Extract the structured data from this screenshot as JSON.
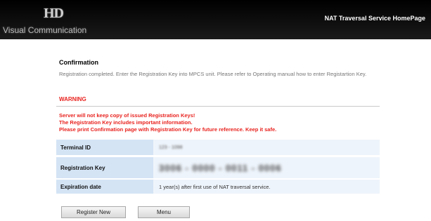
{
  "header": {
    "logo_mark": "HD",
    "logo_sub": "Visual Communication",
    "homepage_link": "NAT Traversal Service HomePage"
  },
  "confirmation": {
    "title": "Confirmation",
    "intro": "Registration completed. Enter the Registration Key into MPCS unit. Please refer to Operating manual how to enter Registartion Key."
  },
  "warning": {
    "title": "WARNING",
    "lines": [
      "Server will not keep copy of issued Registration Keys!",
      "The Registration Key includes important information.",
      "Please print Confirmation page with Registration Key for future reference. Keep it safe."
    ]
  },
  "details": [
    {
      "label": "Terminal ID",
      "value": "123 - 1098"
    },
    {
      "label": "Registration Key",
      "value": "3006 - 0000 - 0011 - 0006"
    },
    {
      "label": "Expiration date",
      "value": "1 year(s) after first use of NAT traversal service."
    }
  ],
  "buttons": {
    "register_new": "Register New",
    "menu": "Menu"
  },
  "colors": {
    "header_bg": "#000000",
    "warning_red": "#e8231f",
    "label_bg": "#d4e4f5",
    "row_bg": "#eef4fb"
  }
}
